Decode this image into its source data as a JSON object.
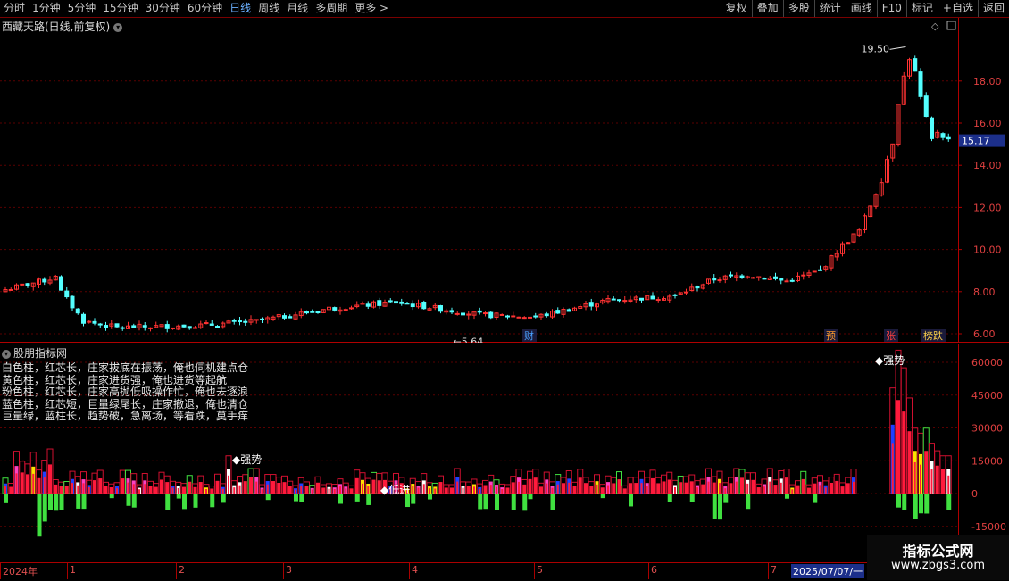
{
  "toolbar": {
    "periods": [
      "分时",
      "1分钟",
      "5分钟",
      "15分钟",
      "30分钟",
      "60分钟",
      "日线",
      "周线",
      "月线",
      "多周期",
      "更多 >"
    ],
    "active_period": "日线",
    "tools": [
      "复权",
      "叠加",
      "多股",
      "统计",
      "画线",
      "F10",
      "标记",
      "+自选",
      "返回"
    ]
  },
  "kline": {
    "title": "西藏天路(日线,前复权)",
    "title_icon": "chevron-down-icon",
    "y_ticks": [
      "18.00",
      "16.00",
      "14.00",
      "12.00",
      "10.00",
      "8.00",
      "6.00"
    ],
    "current_price": "15.17",
    "high_label": "19.50",
    "low_label": "5.64",
    "event_markers": [
      {
        "text": "财",
        "color": "#4aa0ff"
      },
      {
        "text": "预",
        "color": "#ff9a2e"
      },
      {
        "text": "张",
        "color": "#ff4040"
      },
      {
        "text": "榜跌",
        "color": "#ffd24a"
      }
    ],
    "colors": {
      "up": "#ff3232",
      "down": "#54ffff",
      "grid": "#5a0000"
    }
  },
  "indicator": {
    "title": "股朋指标网",
    "legend": [
      "白色柱，红芯长，庄家拔底在振荡，俺也伺机建点仓",
      "黄色柱，红芯长，庄家进货强，俺也进货等起航",
      "粉色柱，红芯长，庄家高抛低吸操作忙，俺也去逐浪",
      "蓝色柱，红芯短，巨量绿尾长，庄家撤退，俺也清仓",
      "巨量绿，蓝柱长，趋势破，急离场，等看跌，莫手痒"
    ],
    "y_ticks": [
      "60000",
      "45000",
      "30000",
      "15000",
      "0",
      "-15000"
    ],
    "annotations": [
      "强势",
      "低进",
      "强势"
    ],
    "colors": {
      "red": "#ff1a3c",
      "green": "#40e040",
      "blue": "#1f3fff",
      "pink": "#ff40c0",
      "yellow": "#ffe000",
      "white": "#ffffff"
    }
  },
  "timeaxis": {
    "labels": [
      "2024年",
      "1",
      "2",
      "3",
      "4",
      "5",
      "6",
      "7"
    ],
    "cursor_date": "2025/07/07/一"
  },
  "watermark": {
    "line1": "指标公式网",
    "line2": "www.zbgs3.com"
  }
}
